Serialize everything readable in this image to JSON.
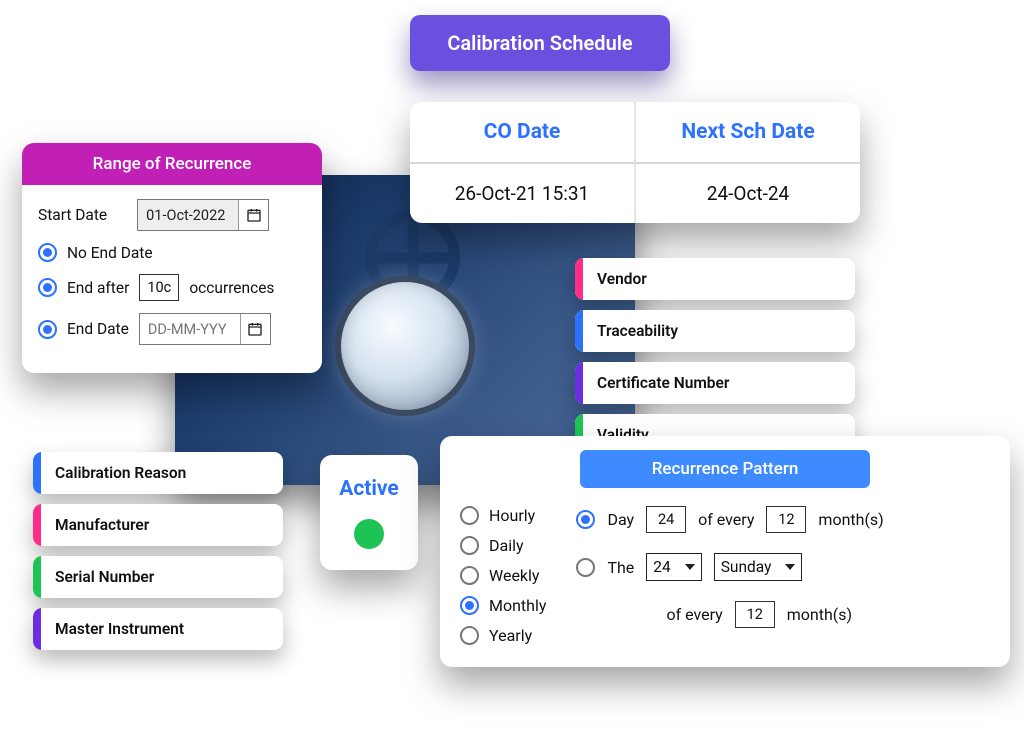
{
  "header": {
    "title": "Calibration Schedule"
  },
  "dates": {
    "co_head": "CO Date",
    "next_head": "Next Sch Date",
    "co_value": "26-Oct-21 15:31",
    "next_value": "24-Oct-24"
  },
  "range": {
    "banner": "Range of Recurrence",
    "start_label": "Start Date",
    "start_value": "01-Oct-2022",
    "no_end": "No End Date",
    "end_after_prefix": "End after",
    "end_after_value": "10c",
    "end_after_suffix": "occurrences",
    "end_date_label": "End Date",
    "end_date_placeholder": "DD-MM-YYY"
  },
  "attrs_left": [
    "Calibration Reason",
    "Manufacturer",
    "Serial Number",
    "Master Instrument"
  ],
  "attrs_right": [
    "Vendor",
    "Traceability",
    "Certificate Number",
    "Validity"
  ],
  "colors_left": [
    "c-blue",
    "c-pink",
    "c-green",
    "c-purple"
  ],
  "colors_right": [
    "c-pink",
    "c-blue",
    "c-purple",
    "c-green"
  ],
  "active": {
    "label": "Active"
  },
  "recur": {
    "banner": "Recurrence Pattern",
    "freq": [
      "Hourly",
      "Daily",
      "Weekly",
      "Monthly",
      "Yearly"
    ],
    "freq_selected": "Monthly",
    "day_label": "Day",
    "day_value": "24",
    "of_every": "of every",
    "months_value": "12",
    "months_suffix": "month(s)",
    "the_label": "The",
    "the_num": "24",
    "the_day": "Sunday",
    "months2_value": "12"
  }
}
